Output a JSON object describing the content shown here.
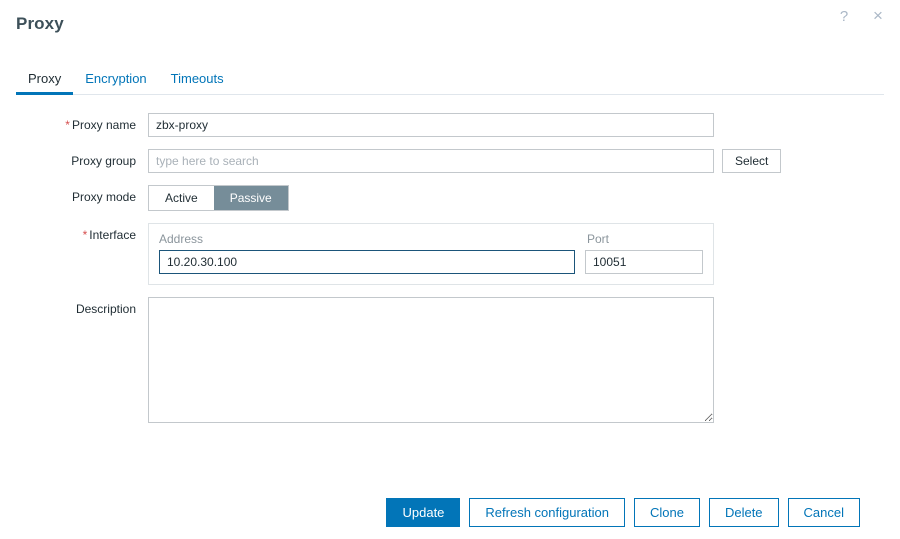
{
  "dialog": {
    "title": "Proxy",
    "help_icon_label": "?",
    "close_icon_label": "×"
  },
  "tabs": [
    {
      "label": "Proxy",
      "active": true
    },
    {
      "label": "Encryption",
      "active": false
    },
    {
      "label": "Timeouts",
      "active": false
    }
  ],
  "form": {
    "proxy_name": {
      "label": "Proxy name",
      "required_marker": "*",
      "value": "zbx-proxy",
      "placeholder": ""
    },
    "proxy_group": {
      "label": "Proxy group",
      "value": "",
      "placeholder": "type here to search",
      "select_button": "Select"
    },
    "proxy_mode": {
      "label": "Proxy mode",
      "options": [
        "Active",
        "Passive"
      ],
      "selected": "Passive"
    },
    "interface": {
      "label": "Interface",
      "required_marker": "*",
      "address_header": "Address",
      "port_header": "Port",
      "address_value": "10.20.30.100",
      "port_value": "10051",
      "address_focused": true
    },
    "description": {
      "label": "Description",
      "value": "",
      "placeholder": ""
    }
  },
  "footer": {
    "buttons": [
      {
        "label": "Update",
        "primary": true
      },
      {
        "label": "Refresh configuration",
        "primary": false
      },
      {
        "label": "Clone",
        "primary": false
      },
      {
        "label": "Delete",
        "primary": false
      },
      {
        "label": "Cancel",
        "primary": false
      }
    ]
  },
  "colors": {
    "accent": "#0275b8",
    "title": "#3d5059",
    "required": "#d64e4e",
    "toggle_selected_bg": "#768d99",
    "placeholder": "#a9b1b8"
  }
}
